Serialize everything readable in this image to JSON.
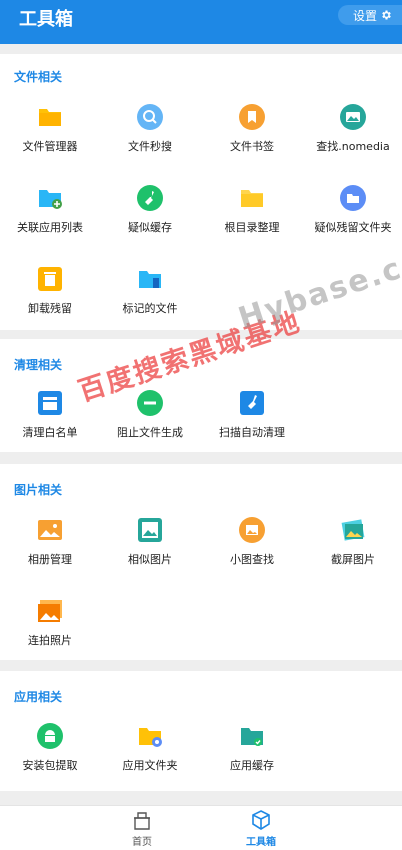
{
  "header": {
    "title": "工具箱",
    "settings_label": "设置"
  },
  "sections": {
    "files": {
      "title": "文件相关",
      "items": [
        "文件管理器",
        "文件秒搜",
        "文件书签",
        "查找.nomedia",
        "关联应用列表",
        "疑似缓存",
        "根目录整理",
        "疑似残留文件夹",
        "卸载残留",
        "标记的文件"
      ]
    },
    "clean": {
      "title": "清理相关",
      "items": [
        "清理白名单",
        "阻止文件生成",
        "扫描自动清理"
      ]
    },
    "images": {
      "title": "图片相关",
      "items": [
        "相册管理",
        "相似图片",
        "小图查找",
        "截屏图片",
        "连拍照片"
      ]
    },
    "apps": {
      "title": "应用相关",
      "items": [
        "安装包提取",
        "应用文件夹",
        "应用缓存"
      ]
    }
  },
  "watermark": {
    "cn": "百度搜索黑域基地",
    "en": "Hybase.com"
  },
  "bottom_nav": {
    "home_label": "首页",
    "toolbox_label": "工具箱"
  },
  "colors": {
    "accent": "#1e88e5",
    "folder": "#ffc107",
    "green": "#1fc16b",
    "orange": "#f7a032"
  }
}
